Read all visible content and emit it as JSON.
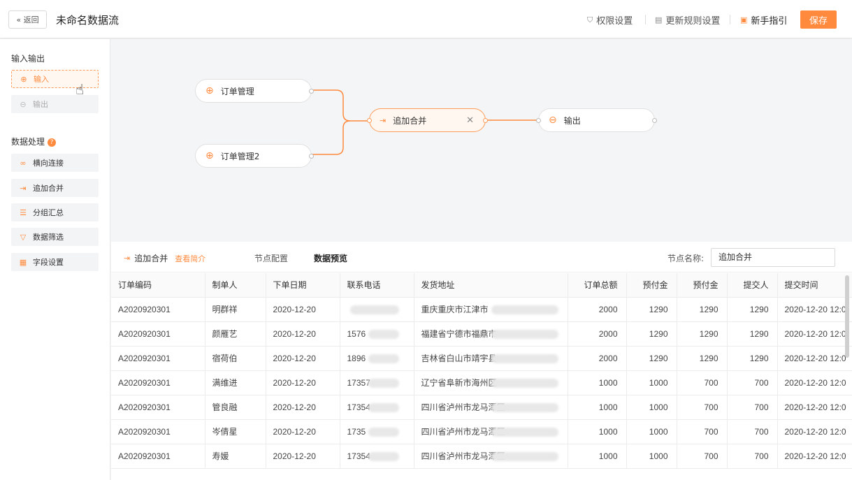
{
  "header": {
    "back_label": "« 返回",
    "title": "未命名数据流",
    "permission_label": "权限设置",
    "update_rules_label": "更新规则设置",
    "guide_label": "新手指引",
    "save_label": "保存"
  },
  "sidebar": {
    "io_title": "输入输出",
    "input_label": "输入",
    "output_label": "输出",
    "processing_title": "数据处理",
    "items": [
      {
        "label": "横向连接",
        "icon": "link-icon"
      },
      {
        "label": "追加合并",
        "icon": "append-icon"
      },
      {
        "label": "分组汇总",
        "icon": "list-icon"
      },
      {
        "label": "数据筛选",
        "icon": "filter-icon"
      },
      {
        "label": "字段设置",
        "icon": "table-icon"
      }
    ]
  },
  "canvas": {
    "node1": "订单管理",
    "node2": "订单管理2",
    "merge": "追加合并",
    "output": "输出"
  },
  "panel": {
    "title": "追加合并",
    "intro_link": "查看简介",
    "tab_config": "节点配置",
    "tab_preview": "数据预览",
    "node_name_label": "节点名称:",
    "node_name_value": "追加合并"
  },
  "table": {
    "headers": [
      "订单编码",
      "制单人",
      "下单日期",
      "联系电话",
      "发货地址",
      "订单总额",
      "预付金",
      "预付金",
      "提交人",
      "提交时间"
    ],
    "rows": [
      {
        "code": "A2020920301",
        "maker": "明群祥",
        "date": "2020-12-20",
        "phone": "",
        "address": "重庆重庆市江津市",
        "total": "2000",
        "prepay1": "1290",
        "prepay2": "1290",
        "submitter": "1290",
        "time": "2020-12-20 12:0"
      },
      {
        "code": "A2020920301",
        "maker": "颜雁艺",
        "date": "2020-12-20",
        "phone": "1576",
        "address": "福建省宁德市福鼎市",
        "total": "2000",
        "prepay1": "1290",
        "prepay2": "1290",
        "submitter": "1290",
        "time": "2020-12-20 12:0"
      },
      {
        "code": "A2020920301",
        "maker": "宿荷伯",
        "date": "2020-12-20",
        "phone": "1896",
        "address": "吉林省白山市靖宇县",
        "total": "2000",
        "prepay1": "1290",
        "prepay2": "1290",
        "submitter": "1290",
        "time": "2020-12-20 12:0"
      },
      {
        "code": "A2020920301",
        "maker": "满维进",
        "date": "2020-12-20",
        "phone": "17357",
        "address": "辽宁省阜新市海州区",
        "total": "1000",
        "prepay1": "1000",
        "prepay2": "700",
        "submitter": "700",
        "time": "2020-12-20 12:0"
      },
      {
        "code": "A2020920301",
        "maker": "管良融",
        "date": "2020-12-20",
        "phone": "17354",
        "address": "四川省泸州市龙马潭区",
        "total": "1000",
        "prepay1": "1000",
        "prepay2": "700",
        "submitter": "700",
        "time": "2020-12-20 12:0"
      },
      {
        "code": "A2020920301",
        "maker": "岑倩星",
        "date": "2020-12-20",
        "phone": "1735",
        "address": "四川省泸州市龙马潭区",
        "total": "1000",
        "prepay1": "1000",
        "prepay2": "700",
        "submitter": "700",
        "time": "2020-12-20 12:0"
      },
      {
        "code": "A2020920301",
        "maker": "寿媛",
        "date": "2020-12-20",
        "phone": "17354",
        "address": "四川省泸州市龙马潭区",
        "total": "1000",
        "prepay1": "1000",
        "prepay2": "700",
        "submitter": "700",
        "time": "2020-12-20 12:0"
      }
    ]
  },
  "colors": {
    "accent": "#ff8a3d",
    "canvas_bg": "#f4f5f7"
  }
}
